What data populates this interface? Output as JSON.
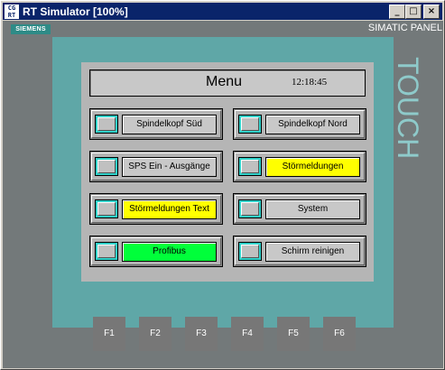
{
  "window": {
    "icon_text": "CG RT",
    "title": "RT Simulator [100%]",
    "minimize": "_",
    "maximize": "□",
    "close": "×"
  },
  "panel": {
    "brand": "SIEMENS",
    "model": "SIMATIC PANEL",
    "side_label": "TOUCH"
  },
  "screen": {
    "title": "Menu",
    "time": "12:18:45",
    "items": [
      {
        "label": "Spindelkopf Süd",
        "color": "#c8c8c8"
      },
      {
        "label": "Spindelkopf Nord",
        "color": "#c8c8c8"
      },
      {
        "label": "SPS Ein - Ausgänge",
        "color": "#c8c8c8"
      },
      {
        "label": "Störmeldungen",
        "color": "#ffff00"
      },
      {
        "label": "Störmeldungen Text",
        "color": "#ffff00"
      },
      {
        "label": "System",
        "color": "#c8c8c8"
      },
      {
        "label": "Profibus",
        "color": "#00ff3a"
      },
      {
        "label": "Schirm reinigen",
        "color": "#c8c8c8"
      }
    ]
  },
  "function_keys": [
    "F1",
    "F2",
    "F3",
    "F4",
    "F5",
    "F6"
  ]
}
